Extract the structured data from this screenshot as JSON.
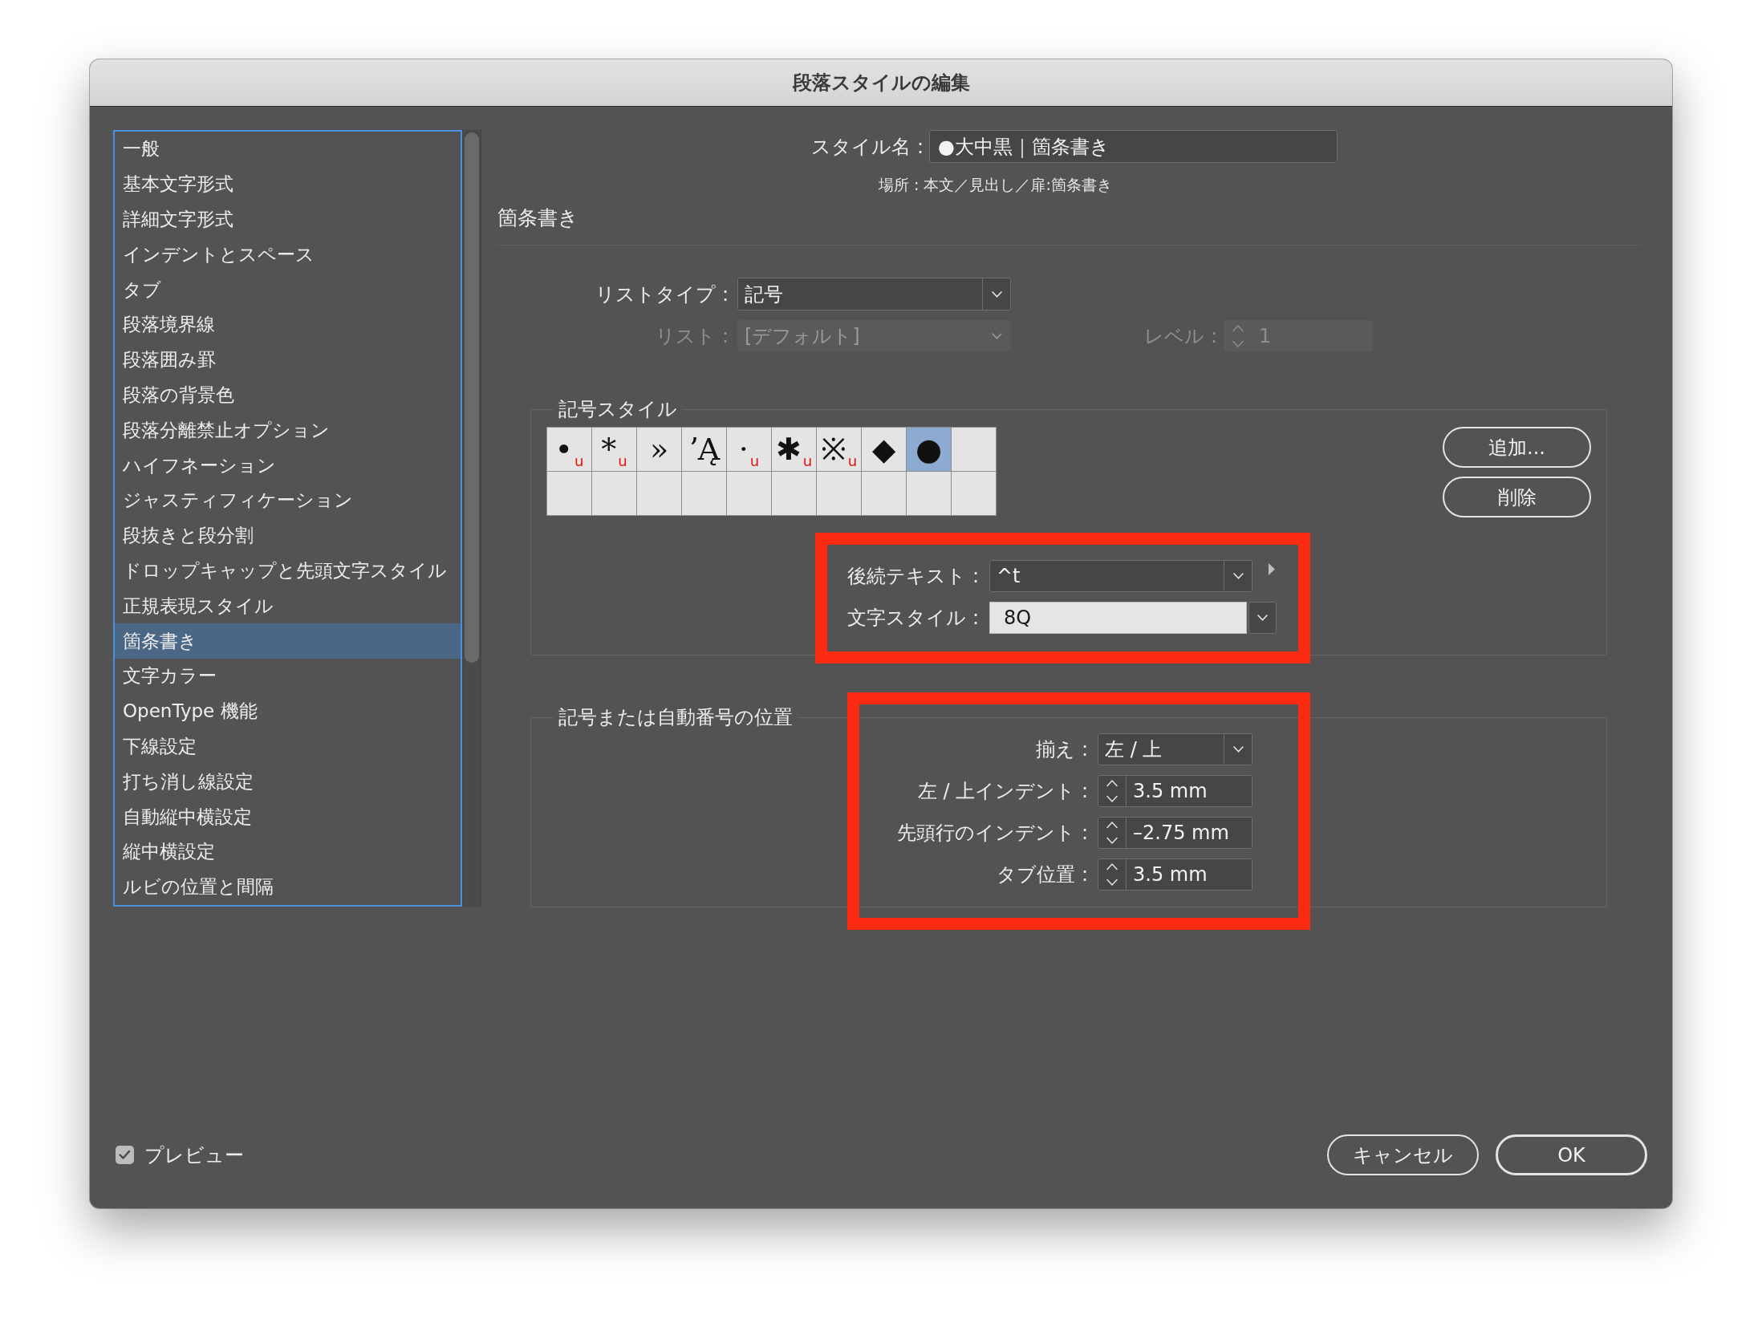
{
  "window": {
    "title": "段落スタイルの編集"
  },
  "sidebar": {
    "items": [
      {
        "label": "一般",
        "selected": false
      },
      {
        "label": "基本文字形式",
        "selected": false
      },
      {
        "label": "詳細文字形式",
        "selected": false
      },
      {
        "label": "インデントとスペース",
        "selected": false
      },
      {
        "label": "タブ",
        "selected": false
      },
      {
        "label": "段落境界線",
        "selected": false
      },
      {
        "label": "段落囲み罫",
        "selected": false
      },
      {
        "label": "段落の背景色",
        "selected": false
      },
      {
        "label": "段落分離禁止オプション",
        "selected": false
      },
      {
        "label": "ハイフネーション",
        "selected": false
      },
      {
        "label": "ジャスティフィケーション",
        "selected": false
      },
      {
        "label": "段抜きと段分割",
        "selected": false
      },
      {
        "label": "ドロップキャップと先頭文字スタイル",
        "selected": false
      },
      {
        "label": "正規表現スタイル",
        "selected": false
      },
      {
        "label": "箇条書き",
        "selected": true
      },
      {
        "label": "文字カラー",
        "selected": false
      },
      {
        "label": "OpenType 機能",
        "selected": false
      },
      {
        "label": "下線設定",
        "selected": false
      },
      {
        "label": "打ち消し線設定",
        "selected": false
      },
      {
        "label": "自動縦中横設定",
        "selected": false
      },
      {
        "label": "縦中横設定",
        "selected": false
      },
      {
        "label": "ルビの位置と間隔",
        "selected": false
      }
    ]
  },
  "style_name": {
    "label": "スタイル名 :",
    "value": "●大中黒｜箇条書き"
  },
  "location": "場所 : 本文／見出し／扉:箇条書き",
  "section_title": "箇条書き",
  "list_type": {
    "label": "リストタイプ :",
    "value": "記号",
    "disabled": false
  },
  "list": {
    "label": "リスト :",
    "value": "[デフォルト]",
    "disabled": true
  },
  "level_field": {
    "label": "レベル :",
    "value": "1",
    "disabled": true
  },
  "bullet_style": {
    "title": "記号スタイル",
    "cells": [
      {
        "kind": "glyph",
        "glyph": "•",
        "mark": "u",
        "selected": false
      },
      {
        "kind": "glyph",
        "glyph": "*",
        "mark": "u",
        "selected": false
      },
      {
        "kind": "glyph",
        "glyph": "»",
        "selected": false
      },
      {
        "kind": "glyph",
        "glyph": "ʼĄ",
        "selected": false
      },
      {
        "kind": "glyph",
        "glyph": "·",
        "mark": "u",
        "selected": false
      },
      {
        "kind": "glyph",
        "glyph": "✱",
        "mark": "u",
        "selected": false
      },
      {
        "kind": "glyph",
        "glyph": "※",
        "mark": "u",
        "selected": false
      },
      {
        "kind": "glyph",
        "glyph": "◆",
        "selected": false
      },
      {
        "kind": "glyph",
        "glyph": "●",
        "selected": true
      },
      {
        "kind": "empty",
        "selected": false
      },
      {
        "kind": "empty",
        "selected": false
      },
      {
        "kind": "empty",
        "selected": false
      },
      {
        "kind": "empty",
        "selected": false
      },
      {
        "kind": "empty",
        "selected": false
      },
      {
        "kind": "empty",
        "selected": false
      },
      {
        "kind": "empty",
        "selected": false
      },
      {
        "kind": "empty",
        "selected": false
      },
      {
        "kind": "empty",
        "selected": false
      },
      {
        "kind": "empty",
        "selected": false
      },
      {
        "kind": "empty",
        "selected": false
      }
    ],
    "buttons": [
      {
        "label": "追加..."
      },
      {
        "label": "削除"
      }
    ],
    "highlighted": true,
    "fields": [
      {
        "kind": "dropdown",
        "label": "後続テキスト :",
        "value": "^t",
        "menu_arrow": true
      },
      {
        "kind": "combo",
        "label": "文字スタイル :",
        "value": "8Q",
        "menu_arrow": false
      }
    ]
  },
  "position": {
    "title": "記号または自動番号の位置",
    "highlighted": true,
    "fields": [
      {
        "kind": "dropdown",
        "label": "揃え :",
        "value": "左 / 上"
      },
      {
        "kind": "spinner",
        "label": "左 / 上インデント :",
        "value": "3.5 mm"
      },
      {
        "kind": "spinner",
        "label": "先頭行のインデント :",
        "value": "–2.75 mm"
      },
      {
        "kind": "spinner",
        "label": "タブ位置 :",
        "value": "3.5 mm"
      }
    ]
  },
  "preview": {
    "label": "プレビュー",
    "checked": true
  },
  "buttons": [
    {
      "label": "キャンセル",
      "default": false
    },
    {
      "label": "OK",
      "default": true
    }
  ]
}
